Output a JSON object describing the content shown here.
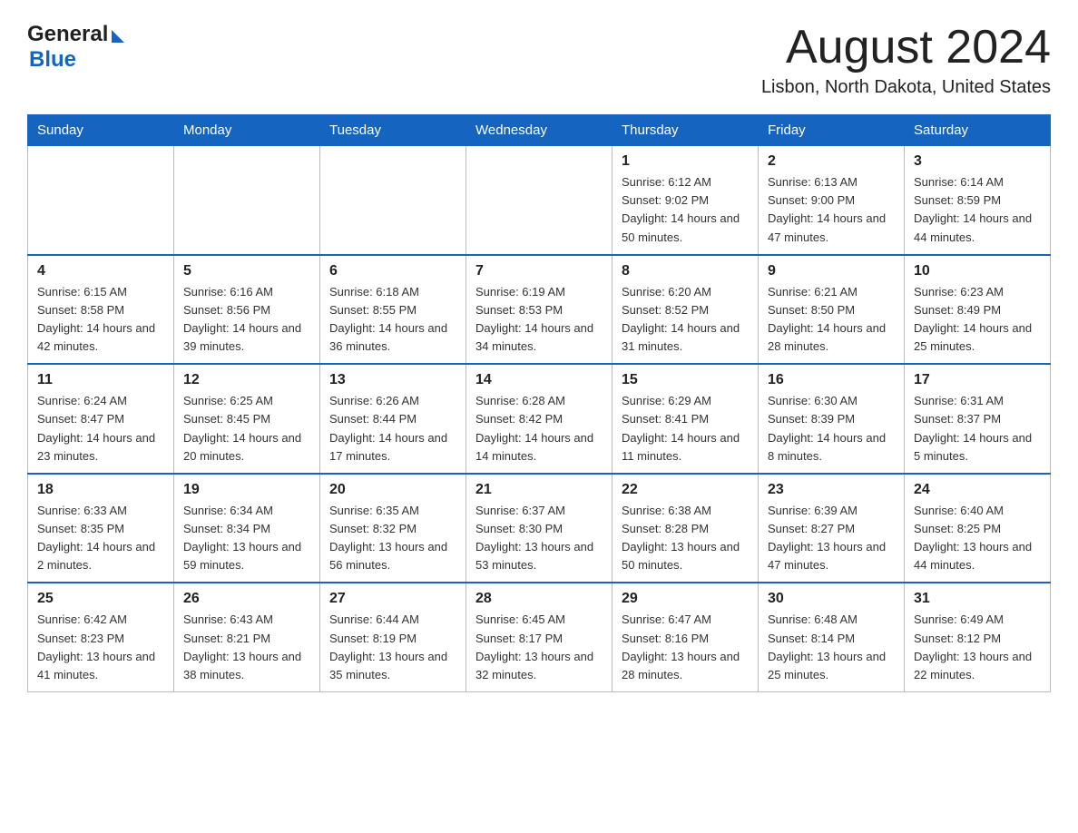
{
  "header": {
    "logo_general": "General",
    "logo_blue": "Blue",
    "title": "August 2024",
    "subtitle": "Lisbon, North Dakota, United States"
  },
  "weekdays": [
    "Sunday",
    "Monday",
    "Tuesday",
    "Wednesday",
    "Thursday",
    "Friday",
    "Saturday"
  ],
  "weeks": [
    [
      {
        "day": "",
        "sunrise": "",
        "sunset": "",
        "daylight": ""
      },
      {
        "day": "",
        "sunrise": "",
        "sunset": "",
        "daylight": ""
      },
      {
        "day": "",
        "sunrise": "",
        "sunset": "",
        "daylight": ""
      },
      {
        "day": "",
        "sunrise": "",
        "sunset": "",
        "daylight": ""
      },
      {
        "day": "1",
        "sunrise": "Sunrise: 6:12 AM",
        "sunset": "Sunset: 9:02 PM",
        "daylight": "Daylight: 14 hours and 50 minutes."
      },
      {
        "day": "2",
        "sunrise": "Sunrise: 6:13 AM",
        "sunset": "Sunset: 9:00 PM",
        "daylight": "Daylight: 14 hours and 47 minutes."
      },
      {
        "day": "3",
        "sunrise": "Sunrise: 6:14 AM",
        "sunset": "Sunset: 8:59 PM",
        "daylight": "Daylight: 14 hours and 44 minutes."
      }
    ],
    [
      {
        "day": "4",
        "sunrise": "Sunrise: 6:15 AM",
        "sunset": "Sunset: 8:58 PM",
        "daylight": "Daylight: 14 hours and 42 minutes."
      },
      {
        "day": "5",
        "sunrise": "Sunrise: 6:16 AM",
        "sunset": "Sunset: 8:56 PM",
        "daylight": "Daylight: 14 hours and 39 minutes."
      },
      {
        "day": "6",
        "sunrise": "Sunrise: 6:18 AM",
        "sunset": "Sunset: 8:55 PM",
        "daylight": "Daylight: 14 hours and 36 minutes."
      },
      {
        "day": "7",
        "sunrise": "Sunrise: 6:19 AM",
        "sunset": "Sunset: 8:53 PM",
        "daylight": "Daylight: 14 hours and 34 minutes."
      },
      {
        "day": "8",
        "sunrise": "Sunrise: 6:20 AM",
        "sunset": "Sunset: 8:52 PM",
        "daylight": "Daylight: 14 hours and 31 minutes."
      },
      {
        "day": "9",
        "sunrise": "Sunrise: 6:21 AM",
        "sunset": "Sunset: 8:50 PM",
        "daylight": "Daylight: 14 hours and 28 minutes."
      },
      {
        "day": "10",
        "sunrise": "Sunrise: 6:23 AM",
        "sunset": "Sunset: 8:49 PM",
        "daylight": "Daylight: 14 hours and 25 minutes."
      }
    ],
    [
      {
        "day": "11",
        "sunrise": "Sunrise: 6:24 AM",
        "sunset": "Sunset: 8:47 PM",
        "daylight": "Daylight: 14 hours and 23 minutes."
      },
      {
        "day": "12",
        "sunrise": "Sunrise: 6:25 AM",
        "sunset": "Sunset: 8:45 PM",
        "daylight": "Daylight: 14 hours and 20 minutes."
      },
      {
        "day": "13",
        "sunrise": "Sunrise: 6:26 AM",
        "sunset": "Sunset: 8:44 PM",
        "daylight": "Daylight: 14 hours and 17 minutes."
      },
      {
        "day": "14",
        "sunrise": "Sunrise: 6:28 AM",
        "sunset": "Sunset: 8:42 PM",
        "daylight": "Daylight: 14 hours and 14 minutes."
      },
      {
        "day": "15",
        "sunrise": "Sunrise: 6:29 AM",
        "sunset": "Sunset: 8:41 PM",
        "daylight": "Daylight: 14 hours and 11 minutes."
      },
      {
        "day": "16",
        "sunrise": "Sunrise: 6:30 AM",
        "sunset": "Sunset: 8:39 PM",
        "daylight": "Daylight: 14 hours and 8 minutes."
      },
      {
        "day": "17",
        "sunrise": "Sunrise: 6:31 AM",
        "sunset": "Sunset: 8:37 PM",
        "daylight": "Daylight: 14 hours and 5 minutes."
      }
    ],
    [
      {
        "day": "18",
        "sunrise": "Sunrise: 6:33 AM",
        "sunset": "Sunset: 8:35 PM",
        "daylight": "Daylight: 14 hours and 2 minutes."
      },
      {
        "day": "19",
        "sunrise": "Sunrise: 6:34 AM",
        "sunset": "Sunset: 8:34 PM",
        "daylight": "Daylight: 13 hours and 59 minutes."
      },
      {
        "day": "20",
        "sunrise": "Sunrise: 6:35 AM",
        "sunset": "Sunset: 8:32 PM",
        "daylight": "Daylight: 13 hours and 56 minutes."
      },
      {
        "day": "21",
        "sunrise": "Sunrise: 6:37 AM",
        "sunset": "Sunset: 8:30 PM",
        "daylight": "Daylight: 13 hours and 53 minutes."
      },
      {
        "day": "22",
        "sunrise": "Sunrise: 6:38 AM",
        "sunset": "Sunset: 8:28 PM",
        "daylight": "Daylight: 13 hours and 50 minutes."
      },
      {
        "day": "23",
        "sunrise": "Sunrise: 6:39 AM",
        "sunset": "Sunset: 8:27 PM",
        "daylight": "Daylight: 13 hours and 47 minutes."
      },
      {
        "day": "24",
        "sunrise": "Sunrise: 6:40 AM",
        "sunset": "Sunset: 8:25 PM",
        "daylight": "Daylight: 13 hours and 44 minutes."
      }
    ],
    [
      {
        "day": "25",
        "sunrise": "Sunrise: 6:42 AM",
        "sunset": "Sunset: 8:23 PM",
        "daylight": "Daylight: 13 hours and 41 minutes."
      },
      {
        "day": "26",
        "sunrise": "Sunrise: 6:43 AM",
        "sunset": "Sunset: 8:21 PM",
        "daylight": "Daylight: 13 hours and 38 minutes."
      },
      {
        "day": "27",
        "sunrise": "Sunrise: 6:44 AM",
        "sunset": "Sunset: 8:19 PM",
        "daylight": "Daylight: 13 hours and 35 minutes."
      },
      {
        "day": "28",
        "sunrise": "Sunrise: 6:45 AM",
        "sunset": "Sunset: 8:17 PM",
        "daylight": "Daylight: 13 hours and 32 minutes."
      },
      {
        "day": "29",
        "sunrise": "Sunrise: 6:47 AM",
        "sunset": "Sunset: 8:16 PM",
        "daylight": "Daylight: 13 hours and 28 minutes."
      },
      {
        "day": "30",
        "sunrise": "Sunrise: 6:48 AM",
        "sunset": "Sunset: 8:14 PM",
        "daylight": "Daylight: 13 hours and 25 minutes."
      },
      {
        "day": "31",
        "sunrise": "Sunrise: 6:49 AM",
        "sunset": "Sunset: 8:12 PM",
        "daylight": "Daylight: 13 hours and 22 minutes."
      }
    ]
  ]
}
